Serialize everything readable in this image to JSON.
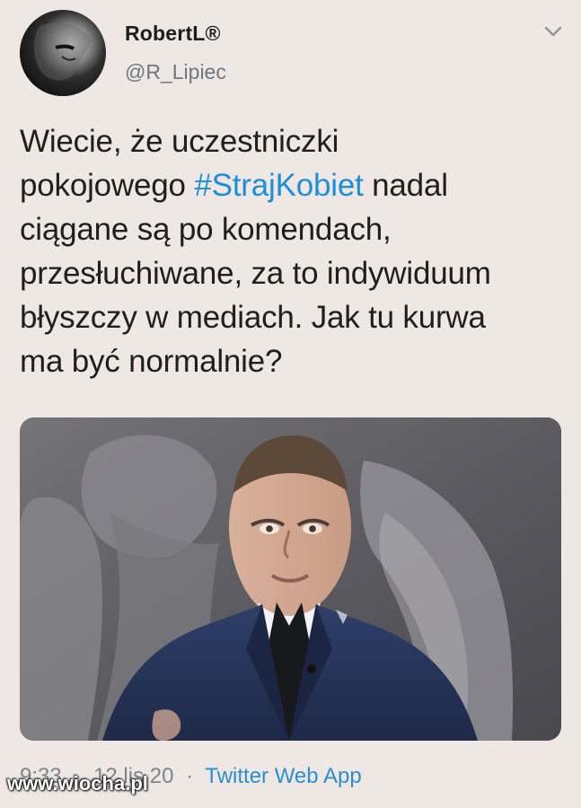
{
  "tweet": {
    "author": {
      "display_name": "RobertL®",
      "handle": "@R_Lipiec"
    },
    "text_parts": [
      "Wiecie, że uczestniczki",
      "pokojowego ",
      "#StrajKobiet",
      " nadal",
      "ciągane są po komendach,",
      "przesłuchiwane, za to indywiduum",
      "błyszczy w mediach. Jak tu kurwa",
      "ma być normalnie?"
    ],
    "meta": {
      "time": "9:33",
      "date": "12 lis 20",
      "source": "Twitter Web App"
    }
  },
  "watermark": {
    "text": "www.wiocha.pl"
  },
  "icons": {
    "avatar": "avatar-icon",
    "chevron": "chevron-down-icon"
  },
  "colors": {
    "background": "#eee7e3",
    "hashtag": "#1d8fd8",
    "meta": "#7b858c",
    "source": "#2a8fcf"
  }
}
